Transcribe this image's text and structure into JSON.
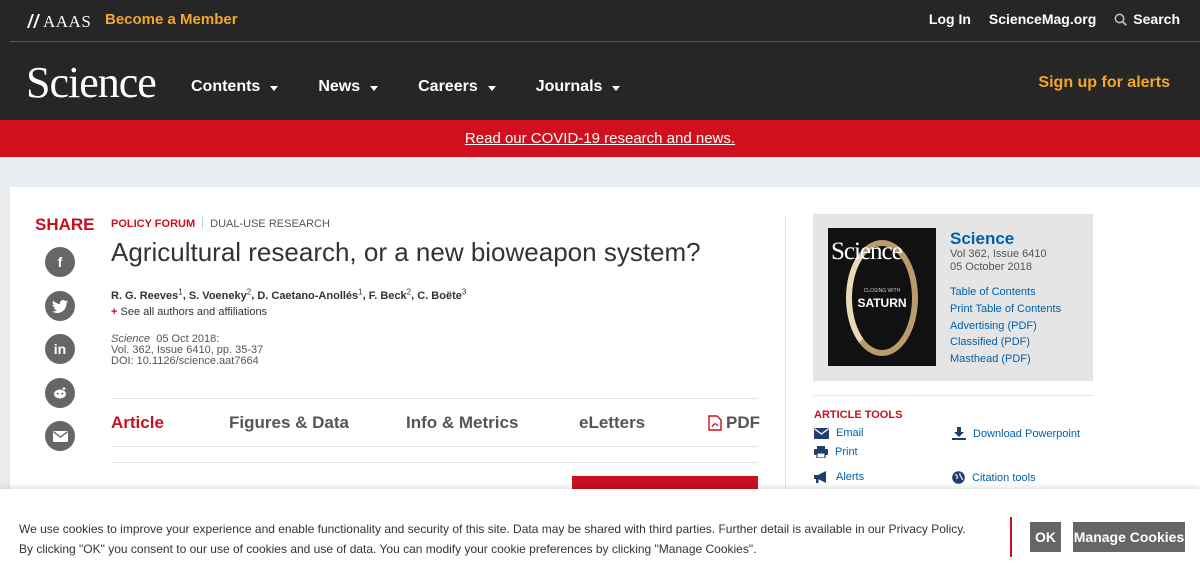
{
  "topbar": {
    "org": "AAAS",
    "become_member": "Become a Member",
    "login": "Log In",
    "sciencemag": "ScienceMag.org",
    "search": "Search"
  },
  "nav": {
    "logo": "Science",
    "items": [
      "Contents",
      "News",
      "Careers",
      "Journals"
    ],
    "signup": "Sign up for alerts"
  },
  "banner": {
    "text": "Read our COVID-19 research and news."
  },
  "share": {
    "label": "SHARE",
    "icons": [
      "facebook-icon",
      "twitter-icon",
      "linkedin-icon",
      "reddit-icon",
      "email-icon"
    ]
  },
  "article": {
    "category": "POLICY FORUM",
    "subcategory": "DUAL-USE RESEARCH",
    "title": "Agricultural research, or a new bioweapon system?",
    "authors": [
      {
        "name": "R. G. Reeves",
        "sup": "1"
      },
      {
        "name": "S. Voeneky",
        "sup": "2"
      },
      {
        "name": "D. Caetano-Anollés",
        "sup": "1"
      },
      {
        "name": "F. Beck",
        "sup": "2"
      },
      {
        "name": "C. Boëte",
        "sup": "3"
      }
    ],
    "see_all": "See all authors and affiliations",
    "journal": "Science",
    "date": "05 Oct 2018:",
    "volume": "Vol. 362, Issue 6410, pp. 35-37",
    "doi": "DOI: 10.1126/science.aat7664"
  },
  "tabs": [
    "Article",
    "Figures & Data",
    "Info & Metrics",
    "eLetters",
    "PDF"
  ],
  "sidebar": {
    "journal": "Science",
    "volume": "Vol 362, Issue 6410",
    "date": "05 October 2018",
    "cover_title": "SATURN",
    "cover_subtitle": "CLOSING WITH",
    "links": [
      "Table of Contents",
      "Print Table of Contents",
      "Advertising (PDF)",
      "Classified (PDF)",
      "Masthead (PDF)"
    ],
    "tools_label": "ARTICLE TOOLS",
    "tools": [
      "Email",
      "Download Powerpoint",
      "Print",
      "Alerts",
      "Citation tools"
    ]
  },
  "cookie": {
    "text": "We use cookies to improve your experience and enable functionality and security of this site. Data may be shared with third parties. Further detail is available in our Privacy Policy. By clicking \"OK\" you consent to our use of cookies and use of data. You can modify your cookie preferences by clicking \"Manage Cookies\".",
    "ok": "OK",
    "manage": "Manage Cookies"
  },
  "colors": {
    "dark": "#262626",
    "accent_orange": "#f4a52b",
    "brand_red": "#c8101f",
    "link_blue": "#0060a8"
  }
}
